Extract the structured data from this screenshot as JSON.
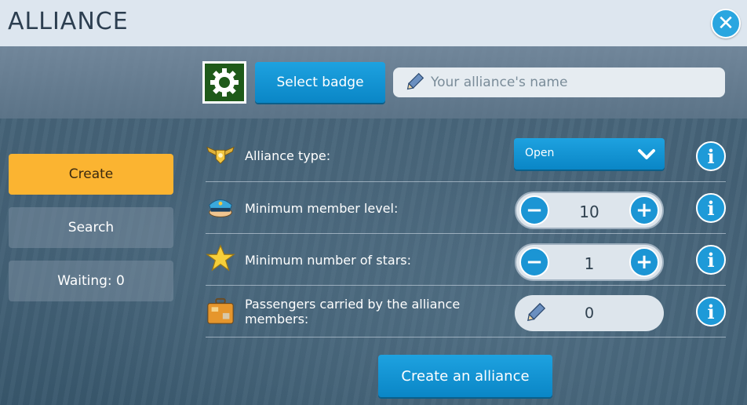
{
  "window": {
    "title": "ALLIANCE"
  },
  "header": {
    "select_badge_label": "Select badge",
    "name_placeholder": "Your alliance's name"
  },
  "sidebar": {
    "items": [
      {
        "label": "Create",
        "active": true
      },
      {
        "label": "Search",
        "active": false
      },
      {
        "label": "Waiting: 0",
        "active": false
      }
    ]
  },
  "form": {
    "alliance_type": {
      "label": "Alliance type:",
      "value": "Open"
    },
    "min_level": {
      "label": "Minimum member level:",
      "value": "10"
    },
    "min_stars": {
      "label": "Minimum number of stars:",
      "value": "1"
    },
    "passengers": {
      "label": "Passengers carried by the alliance members:",
      "value": "0"
    }
  },
  "actions": {
    "create_label": "Create an alliance"
  },
  "colors": {
    "accent_blue": "#1ea2e0",
    "active_tab": "#fbb431",
    "badge_bg": "#1f5a1a"
  },
  "icons": {
    "close": "close-icon",
    "badge": "gear-badge-icon",
    "pencil": "pencil-icon",
    "wings": "wings-badge-icon",
    "cap": "pilot-cap-icon",
    "star": "star-icon",
    "suitcase": "suitcase-icon",
    "info": "info-icon",
    "chevron": "chevron-down-icon"
  }
}
